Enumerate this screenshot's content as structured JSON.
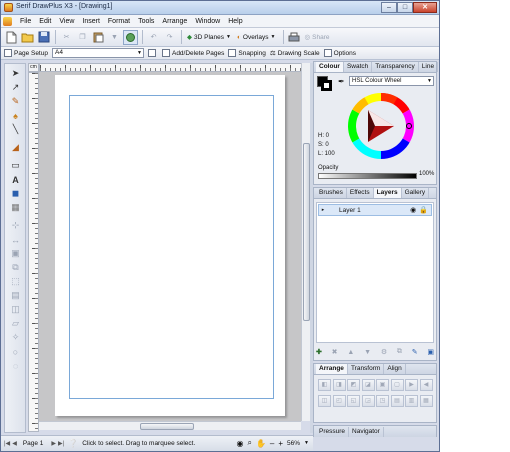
{
  "window": {
    "title": "Serif DrawPlus X3 - [Drawing1]",
    "controls": {
      "minimize": "–",
      "maximize": "□",
      "close": "✕"
    }
  },
  "menu": {
    "items": [
      "File",
      "Edit",
      "View",
      "Insert",
      "Format",
      "Tools",
      "Arrange",
      "Window",
      "Help"
    ]
  },
  "toolbar": {
    "planes_label": "3D Planes",
    "overlays_label": "Overlays",
    "share_label": "Share"
  },
  "context_bar": {
    "page_setup_label": "Page Setup",
    "page_size_value": "A4",
    "add_delete_pages_label": "Add/Delete Pages",
    "snapping_label": "Snapping",
    "drawing_scale_label": "Drawing Scale",
    "options_label": "Options"
  },
  "rulers": {
    "corner_label": "cm"
  },
  "colour_panel": {
    "tabs": [
      "Colour",
      "Swatch",
      "Transparency",
      "Line"
    ],
    "active_tab": "Colour",
    "model_value": "HSL Colour Wheel",
    "hsl": {
      "h": "H: 0",
      "s": "S: 0",
      "l": "L: 100"
    },
    "opacity_label": "Opacity",
    "opacity_value": "100%"
  },
  "layers_panel": {
    "tabs": [
      "Brushes",
      "Effects",
      "Layers",
      "Gallery"
    ],
    "active_tab": "Layers",
    "layers": [
      {
        "name": "Layer 1"
      }
    ]
  },
  "arrange_panel": {
    "tabs": [
      "Arrange",
      "Transform",
      "Align"
    ],
    "active_tab": "Arrange"
  },
  "nav_panel": {
    "tabs": [
      "Pressure",
      "Navigator"
    ]
  },
  "statusbar": {
    "page_label": "Page 1",
    "hint": "Click to select. Drag to marquee select.",
    "zoom": "56%"
  },
  "colors": {
    "accent": "#7aa8d8",
    "chrome": "#d6dbe9",
    "canvas": "#c6c6c8",
    "layer_selected": "#dbe8f8"
  }
}
